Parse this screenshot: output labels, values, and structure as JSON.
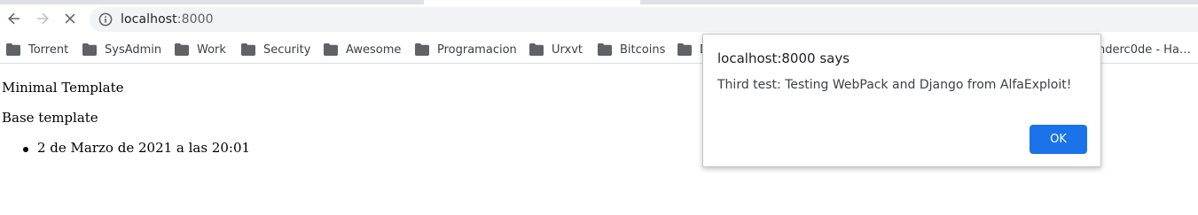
{
  "browser": {
    "url_host": "localhost",
    "url_port": ":8000"
  },
  "bookmarks": [
    {
      "label": "Torrent",
      "icon": "folder-icon"
    },
    {
      "label": "SysAdmin",
      "icon": "folder-icon"
    },
    {
      "label": "Work",
      "icon": "folder-icon"
    },
    {
      "label": "Security",
      "icon": "folder-icon"
    },
    {
      "label": "Awesome",
      "icon": "folder-icon"
    },
    {
      "label": "Programacion",
      "icon": "folder-icon"
    },
    {
      "label": "Urxvt",
      "icon": "folder-icon"
    },
    {
      "label": "Bitcoins",
      "icon": "folder-icon"
    },
    {
      "label": "D",
      "icon": "folder-icon"
    },
    {
      "label": "nderc0de - Ha…",
      "icon": ""
    }
  ],
  "page": {
    "line1": "Minimal Template",
    "line2": "Base template",
    "list": [
      "2 de Marzo de 2021 a las 20:01"
    ]
  },
  "dialog": {
    "title": "localhost:8000 says",
    "message": "Third test: Testing WebPack and Django from AlfaExploit!",
    "ok_label": "OK"
  },
  "colors": {
    "accent": "#1a73e8",
    "omnibox_bg": "#f1f3f4",
    "tabstrip_bg": "#dee1e6"
  }
}
